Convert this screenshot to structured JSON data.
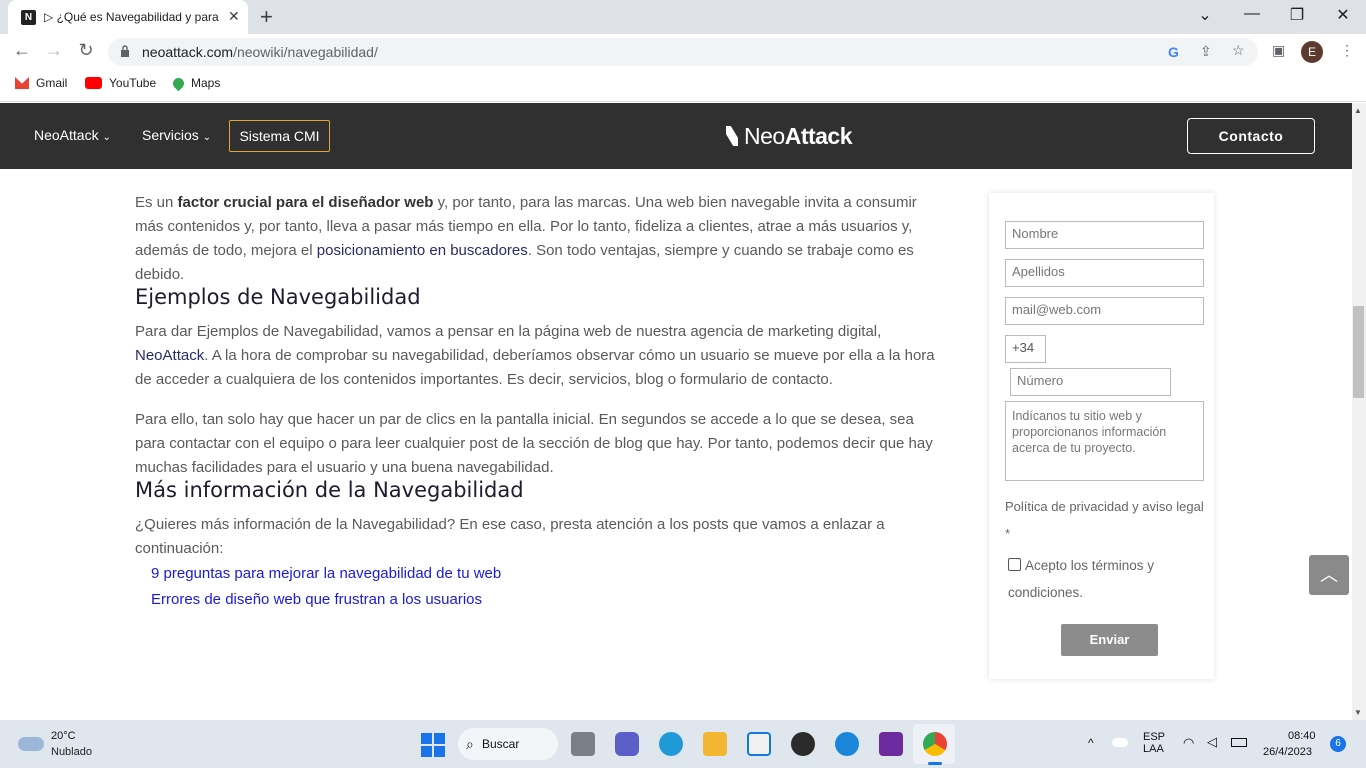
{
  "browser": {
    "tab_title": "▷ ¿Qué es Navegabilidad y para",
    "tab_close": "✕",
    "new_tab": "+",
    "url_host": "neoattack.com",
    "url_path": "/neowiki/navegabilidad/",
    "avatar_letter": "E",
    "window_controls": [
      "⌄",
      "—",
      "❐",
      "✕"
    ],
    "bookmarks": [
      {
        "label": "Gmail",
        "icon": "gmail-icon",
        "color": "#ea4335"
      },
      {
        "label": "YouTube",
        "icon": "youtube-icon",
        "color": "#ff0000"
      },
      {
        "label": "Maps",
        "icon": "maps-icon",
        "color": "#34a853"
      }
    ]
  },
  "site": {
    "menu": {
      "neoattack": "NeoAttack",
      "servicios": "Servicios",
      "sistema_cmi": "Sistema CMI"
    },
    "logo_regular": "Neo",
    "logo_bold": "Attack",
    "contacto": "Contacto",
    "accent_color": "#e8a13a",
    "header_color": "#303030"
  },
  "article": {
    "p1_a": "Es un ",
    "p1_bold": "factor crucial para el diseñador web",
    "p1_b": " y, por tanto, para las marcas. Una web bien navegable invita a consumir más contenidos y, por tanto, lleva a pasar más tiempo en ella. Por lo tanto, fideliza a clientes, atrae a más usuarios y, además de todo, mejora el ",
    "p1_link": "posicionamiento en buscadores",
    "p1_c": ". Son todo ventajas, siempre y cuando se trabaje como es debido.",
    "h2_examples": "Ejemplos de Navegabilidad",
    "p2_a": "Para dar Ejemplos de Navegabilidad, vamos a pensar en la página web de nuestra agencia de marketing digital, ",
    "p2_link": "NeoAttack",
    "p2_b": ". A la hora de comprobar su navegabilidad, deberíamos observar cómo un usuario se mueve por ella a la hora de acceder a cualquiera de los contenidos importantes. Es decir, servicios, blog o formulario de contacto.",
    "p3": "Para ello, tan solo hay que hacer un par de clics en la pantalla inicial. En segundos se accede a lo que se desea, sea para contactar con el equipo o para leer cualquier post de la sección de blog que hay. Por tanto, podemos decir que hay muchas facilidades para el usuario y una buena navegabilidad.",
    "h2_more": "Más información de la Navegabilidad",
    "p4": "¿Quieres más información de la Navegabilidad? En ese caso, presta atención a los posts que vamos a enlazar a continuación:",
    "links": [
      "9 preguntas para mejorar la navegabilidad de tu web",
      "Errores de diseño web que frustran a los usuarios"
    ]
  },
  "form": {
    "nombre_placeholder": "Nombre",
    "apellidos_placeholder": "Apellidos",
    "email_placeholder": "mail@web.com",
    "prefix": "+34",
    "numero_placeholder": "Número",
    "message_placeholder": "Indícanos tu sitio web y proporcionanos información acerca de tu proyecto.",
    "policy": "Política de privacidad y aviso legal",
    "required": "*",
    "accept": "Acepto los términos y condiciones.",
    "submit": "Enviar"
  },
  "taskbar": {
    "temp": "20°C",
    "condition": "Nublado",
    "search": "Buscar",
    "lang1": "ESP",
    "lang2": "LAA",
    "time": "08:40",
    "date": "26/4/2023",
    "notifications": "6"
  }
}
